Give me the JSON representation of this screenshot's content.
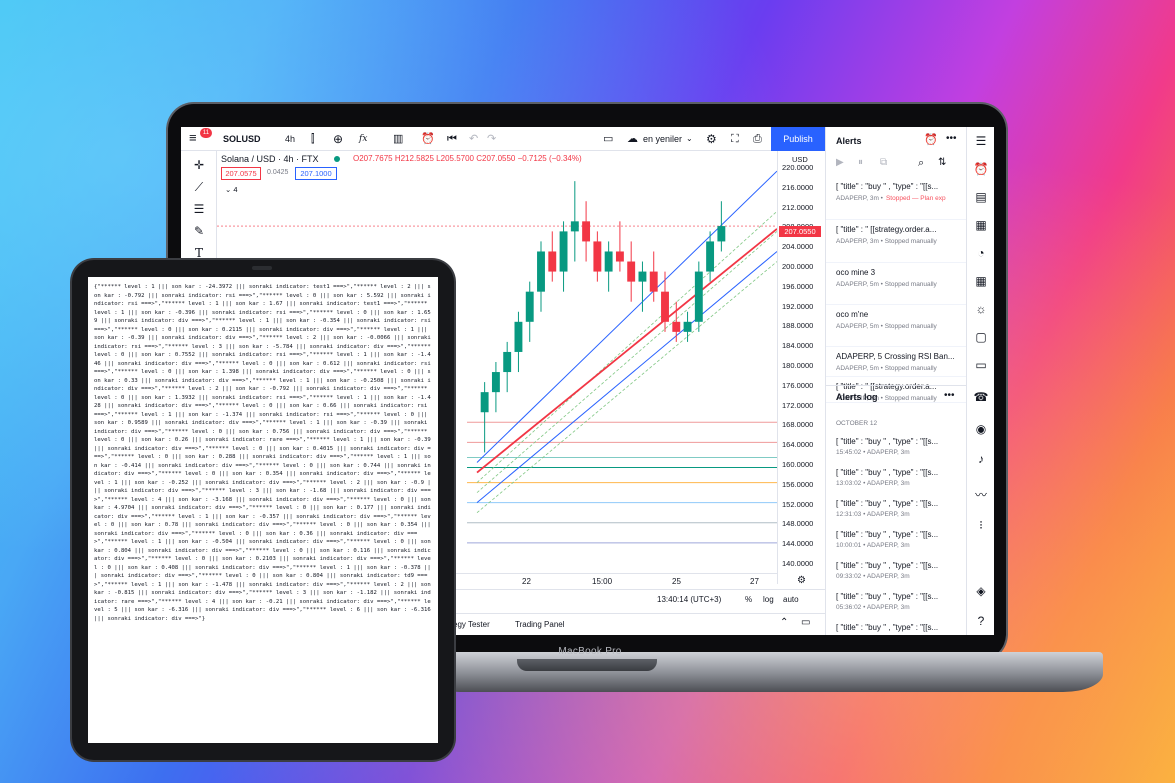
{
  "topbar": {
    "symbol": "SOLUSD",
    "interval": "4h",
    "fx_label": "fx",
    "layout_name": "en yeniler",
    "publish_label": "Publish",
    "notif_count": "11"
  },
  "legend": {
    "title": "Solana / USD · 4h · FTX",
    "ohlc": "O207.7675 H212.5825 L205.5700 C207.0550 −0.7125 (−0.34%)",
    "bid": "207.0575",
    "spread": "0.0425",
    "ask": "207.1000",
    "collapse": "4"
  },
  "price_axis": {
    "currency": "USD",
    "ticks": [
      "220.0000",
      "216.0000",
      "212.0000",
      "208.0000",
      "204.0000",
      "200.0000",
      "196.0000",
      "192.0000",
      "188.0000",
      "184.0000",
      "180.0000",
      "176.0000",
      "172.0000",
      "168.0000",
      "164.0000",
      "160.0000",
      "156.0000",
      "152.0000",
      "148.0000",
      "144.0000",
      "140.0000"
    ],
    "current_price": "207.0550"
  },
  "time_axis": {
    "labels": [
      "22",
      "15:00",
      "25",
      "27"
    ]
  },
  "bottombar": {
    "clock": "13:40:14 (UTC+3)",
    "percent": "%",
    "log": "log",
    "auto": "auto"
  },
  "tabs": {
    "strategy": "egy Tester",
    "trading": "Trading Panel"
  },
  "alerts": {
    "title": "Alerts",
    "items": [
      {
        "title": "[ \"title\" : \"buy \" , \"type\" : \"[[s...",
        "sub": "ADAPERP, 3m •",
        "status": "Stopped — Plan exp"
      },
      {
        "title": "[ \"title\" : \" [[strategy.order.a...",
        "sub": "ADAPERP, 3m • Stopped manually",
        "status": ""
      },
      {
        "title": "oco mine 3",
        "sub": "ADAPERP, 5m • Stopped manually",
        "status": ""
      },
      {
        "title": "oco m'ne",
        "sub": "ADAPERP, 5m • Stopped manually",
        "status": ""
      },
      {
        "title": "ADAPERP, 5 Crossing RSI Ban...",
        "sub": "ADAPERP, 5m • Stopped manually",
        "status": ""
      },
      {
        "title": "[ \"title\" : \" [[strategy.order.a...",
        "sub": "ADAPERP, 3m • Stopped manually",
        "status": ""
      }
    ]
  },
  "alerts_log": {
    "title": "Alerts log",
    "date": "OCTOBER 12",
    "items": [
      {
        "title": "[ \"title\" : \"buy \" , \"type\" : \"[[s...",
        "sub": "15:45:02 • ADAPERP, 3m"
      },
      {
        "title": "[ \"title\" : \"buy \" , \"type\" : \"[[s...",
        "sub": "13:03:02 • ADAPERP, 3m"
      },
      {
        "title": "[ \"title\" : \"buy \" , \"type\" : \"[[s...",
        "sub": "12:31:03 • ADAPERP, 3m"
      },
      {
        "title": "[ \"title\" : \"buy \" , \"type\" : \"[[s...",
        "sub": "10:00:01 • ADAPERP, 3m"
      },
      {
        "title": "[ \"title\" : \"buy \" , \"type\" : \"[[s...",
        "sub": "09:33:02 • ADAPERP, 3m"
      },
      {
        "title": "[ \"title\" : \"buy \" , \"type\" : \"[[s...",
        "sub": "05:36:02 • ADAPERP, 3m"
      },
      {
        "title": "[ \"title\" : \"buy \" , \"type\" : \"[[s...",
        "sub": ""
      }
    ]
  },
  "device": {
    "laptop_brand": "MacBook Pro"
  },
  "tablet_log": "{\"****** level : 1 ||| son kar : -24.3972 ||| sonraki indicator: test1 ===>\",\"****** level : 2 ||| son kar : -0.792 ||| sonraki indicator: rsi ===>\",\"****** level : 0 ||| son kar : 5.592 ||| sonraki indicator: rsi ===>\",\"****** level : 1 ||| son kar : 1.67 ||| sonraki indicator: test1 ===>\",\"****** level : 1 ||| son kar : -0.396 ||| sonraki indicator: rsi ===>\",\"****** level : 0 ||| son kar : 1.659 ||| sonraki indicator: div ===>\",\"****** level : 1 ||| son kar : -0.354 ||| sonraki indicator: rsi ===>\",\"****** level : 0 ||| son kar : 0.2115 ||| sonraki indicator: div ===>\",\"****** level : 1 ||| son kar : -0.39 ||| sonraki indicator: div ===>\",\"****** level : 2 ||| son kar : -0.0066 ||| sonraki indicator: rsi ===>\",\"****** level : 3 ||| son kar : -5.784 ||| sonraki indicator: div ===>\",\"****** level : 0 ||| son kar : 0.7552 ||| sonraki indicator: rsi ===>\",\"****** level : 1 ||| son kar : -1.446 ||| sonraki indicator: div ===>\",\"****** level : 0 ||| son kar : 0.612 ||| sonraki indicator: rsi ===>\",\"****** level : 0 ||| son kar : 1.398 ||| sonraki indicator: div ===>\",\"****** level : 0 ||| son kar : 0.33 ||| sonraki indicator: div ===>\",\"****** level : 1 ||| son kar : -0.2508 ||| sonraki indicator: div ===>\",\"****** level : 2 ||| son kar : -0.792 ||| sonraki indicator: div ===>\",\"****** level : 0 ||| son kar : 1.3932 ||| sonraki indicator: rsi ===>\",\"****** level : 1 ||| son kar : -1.428 ||| sonraki indicator: div ===>\",\"****** level : 0 ||| son kar : 0.66 ||| sonraki indicator: rsi ===>\",\"****** level : 1 ||| son kar : -1.374 ||| sonraki indicator: rsi ===>\",\"****** level : 0 ||| son kar : 0.9589 ||| sonraki indicator: div ===>\",\"****** level : 1 ||| son kar : -0.39 ||| sonraki indicator: div ===>\",\"****** level : 0 ||| son kar : 0.756 ||| sonraki indicator: div ===>\",\"****** level : 0 ||| son kar : 0.26 ||| sonraki indicator: rare ===>\",\"****** level : 1 ||| son kar : -0.39 ||| sonraki indicator: div ===>\",\"****** level : 0 ||| son kar : 0.4015 ||| sonraki indicator: div ===>\",\"****** level : 0 ||| son kar : 0.288 ||| sonraki indicator: div ===>\",\"****** level : 1 ||| son kar : -0.414 ||| sonraki indicator: div ===>\",\"****** level : 0 ||| son kar : 0.744 ||| sonraki indicator: div ===>\",\"****** level : 0 ||| son kar : 0.354 ||| sonraki indicator: div ===>\",\"****** level : 1 ||| son kar : -0.252 ||| sonraki indicator: div ===>\",\"****** level : 2 ||| son kar : -0.9 ||| sonraki indicator: div ===>\",\"****** level : 3 ||| son kar : -1.68 ||| sonraki indicator: div ===>\",\"****** level : 4 ||| son kar : -3.168 ||| sonraki indicator: div ===>\",\"****** level : 0 ||| son kar : 4.9704 ||| sonraki indicator: div ===>\",\"****** level : 0 ||| son kar : 0.177 ||| sonraki indicator: div ===>\",\"****** level : 1 ||| son kar : -0.357 ||| sonraki indicator: div ===>\",\"****** level : 0 ||| son kar : 0.78 ||| sonraki indicator: div ===>\",\"****** level : 0 ||| son kar : 0.354 ||| sonraki indicator: div ===>\",\"****** level : 0 ||| son kar : 0.36 ||| sonraki indicator: div ===>\",\"****** level : 1 ||| son kar : -0.504 ||| sonraki indicator: div ===>\",\"****** level : 0 ||| son kar : 0.804 ||| sonraki indicator: div ===>\",\"****** level : 0 ||| son kar : 0.116 ||| sonraki indicator: div ===>\",\"****** level : 0 ||| son kar : 0.2103 ||| sonraki indicator: div ===>\",\"****** level : 0 ||| son kar : 0.408 ||| sonraki indicator: div ===>\",\"****** level : 1 ||| son kar : -0.378 ||| sonraki indicator: div ===>\",\"****** level : 0 ||| son kar : 0.804 ||| sonraki indicator: td9 ===>\",\"****** level : 1 ||| son kar : -1.478 ||| sonraki indicator: div ===>\",\"****** level : 2 ||| son kar : -0.815 ||| sonraki indicator: div ===>\",\"****** level : 3 ||| son kar : -1.182 ||| sonraki indicator: rare ===>\",\"****** level : 4 ||| son kar : -0.21 ||| sonraki indicator: div ===>\",\"****** level : 5 ||| son kar : -6.316 ||| sonraki indicator: div ===>\",\"****** level : 6 ||| son kar : -6.316 ||| sonraki indicator: div ===>\"}",
  "chart_data": {
    "type": "candlestick",
    "ylim": [
      138,
      222
    ],
    "candles": [
      [
        170,
        176,
        162,
        174
      ],
      [
        174,
        180,
        170,
        178
      ],
      [
        178,
        184,
        174,
        182
      ],
      [
        182,
        190,
        178,
        188
      ],
      [
        188,
        196,
        184,
        194
      ],
      [
        194,
        204,
        190,
        202
      ],
      [
        202,
        206,
        196,
        198
      ],
      [
        198,
        208,
        194,
        206
      ],
      [
        206,
        216,
        200,
        208
      ],
      [
        208,
        212,
        200,
        204
      ],
      [
        204,
        206,
        196,
        198
      ],
      [
        198,
        204,
        194,
        202
      ],
      [
        202,
        208,
        198,
        200
      ],
      [
        200,
        204,
        192,
        196
      ],
      [
        196,
        200,
        190,
        198
      ],
      [
        198,
        202,
        192,
        194
      ],
      [
        194,
        198,
        186,
        188
      ],
      [
        188,
        192,
        184,
        186
      ],
      [
        186,
        190,
        184,
        188
      ],
      [
        188,
        200,
        186,
        198
      ],
      [
        198,
        206,
        196,
        204
      ],
      [
        204,
        212,
        202,
        207.05
      ]
    ],
    "channels": [
      {
        "name": "",
        "color": "#2962ff",
        "points": [
          [
            160,
            202
          ]
        ]
      },
      {
        "name": "",
        "color": "#f23645",
        "points": [
          [
            164,
            200
          ]
        ]
      }
    ],
    "colors": {
      "up": "#089981",
      "down": "#f23645"
    }
  }
}
